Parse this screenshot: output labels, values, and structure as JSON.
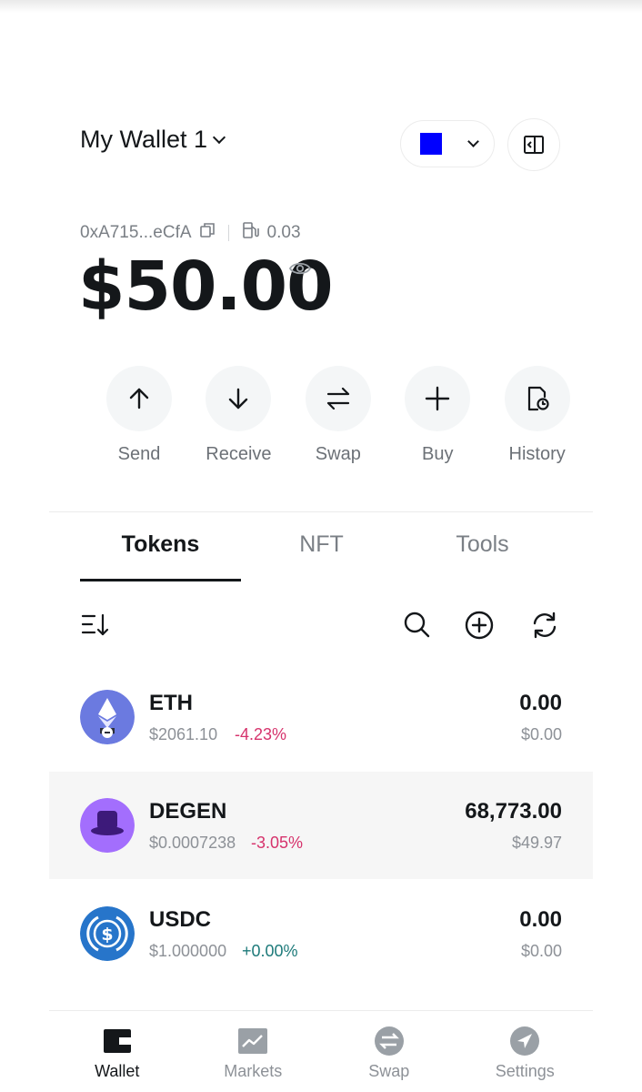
{
  "header": {
    "wallet_name": "My Wallet 1",
    "network_color": "#0000FF"
  },
  "account": {
    "address": "0xA715...eCfA",
    "gas": "0.03",
    "balance": "$50.00"
  },
  "actions": [
    {
      "label": "Send",
      "icon": "arrow-up-icon"
    },
    {
      "label": "Receive",
      "icon": "arrow-down-icon"
    },
    {
      "label": "Swap",
      "icon": "swap-icon"
    },
    {
      "label": "Buy",
      "icon": "plus-icon"
    },
    {
      "label": "History",
      "icon": "history-icon"
    }
  ],
  "tabs": [
    {
      "label": "Tokens",
      "active": true
    },
    {
      "label": "NFT",
      "active": false
    },
    {
      "label": "Tools",
      "active": false
    }
  ],
  "tokens": [
    {
      "symbol": "ETH",
      "price": "$2061.10",
      "change": "-4.23%",
      "amount": "0.00",
      "value": "$0.00"
    },
    {
      "symbol": "DEGEN",
      "price": "$0.0007238",
      "change": "-3.05%",
      "amount": "68,773.00",
      "value": "$49.97"
    },
    {
      "symbol": "USDC",
      "price": "$1.000000",
      "change": "+0.00%",
      "amount": "0.00",
      "value": "$0.00"
    }
  ],
  "colors": {
    "negative": "#d6336c",
    "neutral_positive": "#1d7a7a",
    "eth": "#6b7ae0",
    "degen": "#a36efd",
    "usdc": "#2775ca"
  },
  "nav": [
    {
      "label": "Wallet",
      "active": true
    },
    {
      "label": "Markets",
      "active": false
    },
    {
      "label": "Swap",
      "active": false
    },
    {
      "label": "Settings",
      "active": false
    }
  ]
}
